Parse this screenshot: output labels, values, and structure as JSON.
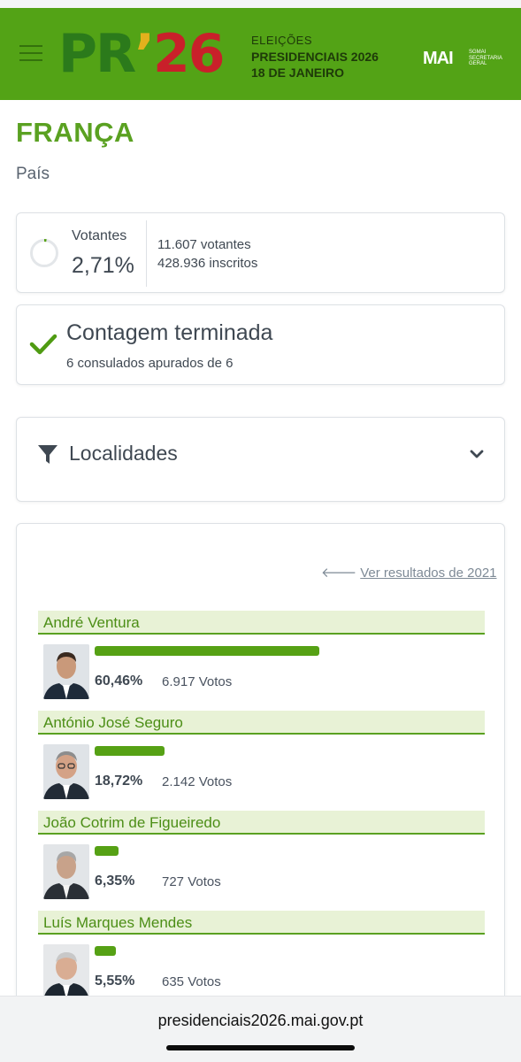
{
  "header": {
    "logo_pr": "PR",
    "logo_quote": "’",
    "logo_num": "26",
    "election_line1": "ELEIÇÕES",
    "election_line2": "PRESIDENCIAIS 2026",
    "election_line3": "18 DE JANEIRO",
    "mai_mark": "MAI",
    "mai_sub": "SGMAI SECRETARIA GERAL"
  },
  "location": {
    "name": "FRANÇA",
    "type": "País"
  },
  "turnout": {
    "label": "Votantes",
    "percent": "2,71%",
    "voters": "11.607 votantes",
    "registered": "428.936 inscritos",
    "fraction": 0.0271
  },
  "count_status": {
    "title": "Contagem terminada",
    "subtitle": "6 consulados apurados de 6"
  },
  "filter": {
    "label": "Localidades"
  },
  "results": {
    "previous_link": "Ver resultados de 2021",
    "candidates": [
      {
        "name": "André Ventura",
        "percent": "60,46%",
        "votes": "6.917 Votos",
        "share": 60.46
      },
      {
        "name": "António José Seguro",
        "percent": "18,72%",
        "votes": "2.142 Votos",
        "share": 18.72
      },
      {
        "name": "João Cotrim de Figueiredo",
        "percent": "6,35%",
        "votes": "727 Votos",
        "share": 6.35
      },
      {
        "name": "Luís Marques Mendes",
        "percent": "5,55%",
        "votes": "635 Votos",
        "share": 5.55
      }
    ]
  },
  "footer": {
    "url": "presidenciais2026.mai.gov.pt"
  },
  "colors": {
    "brand_green": "#53a316",
    "text_green": "#5aa121",
    "bar_green": "#56a115"
  }
}
